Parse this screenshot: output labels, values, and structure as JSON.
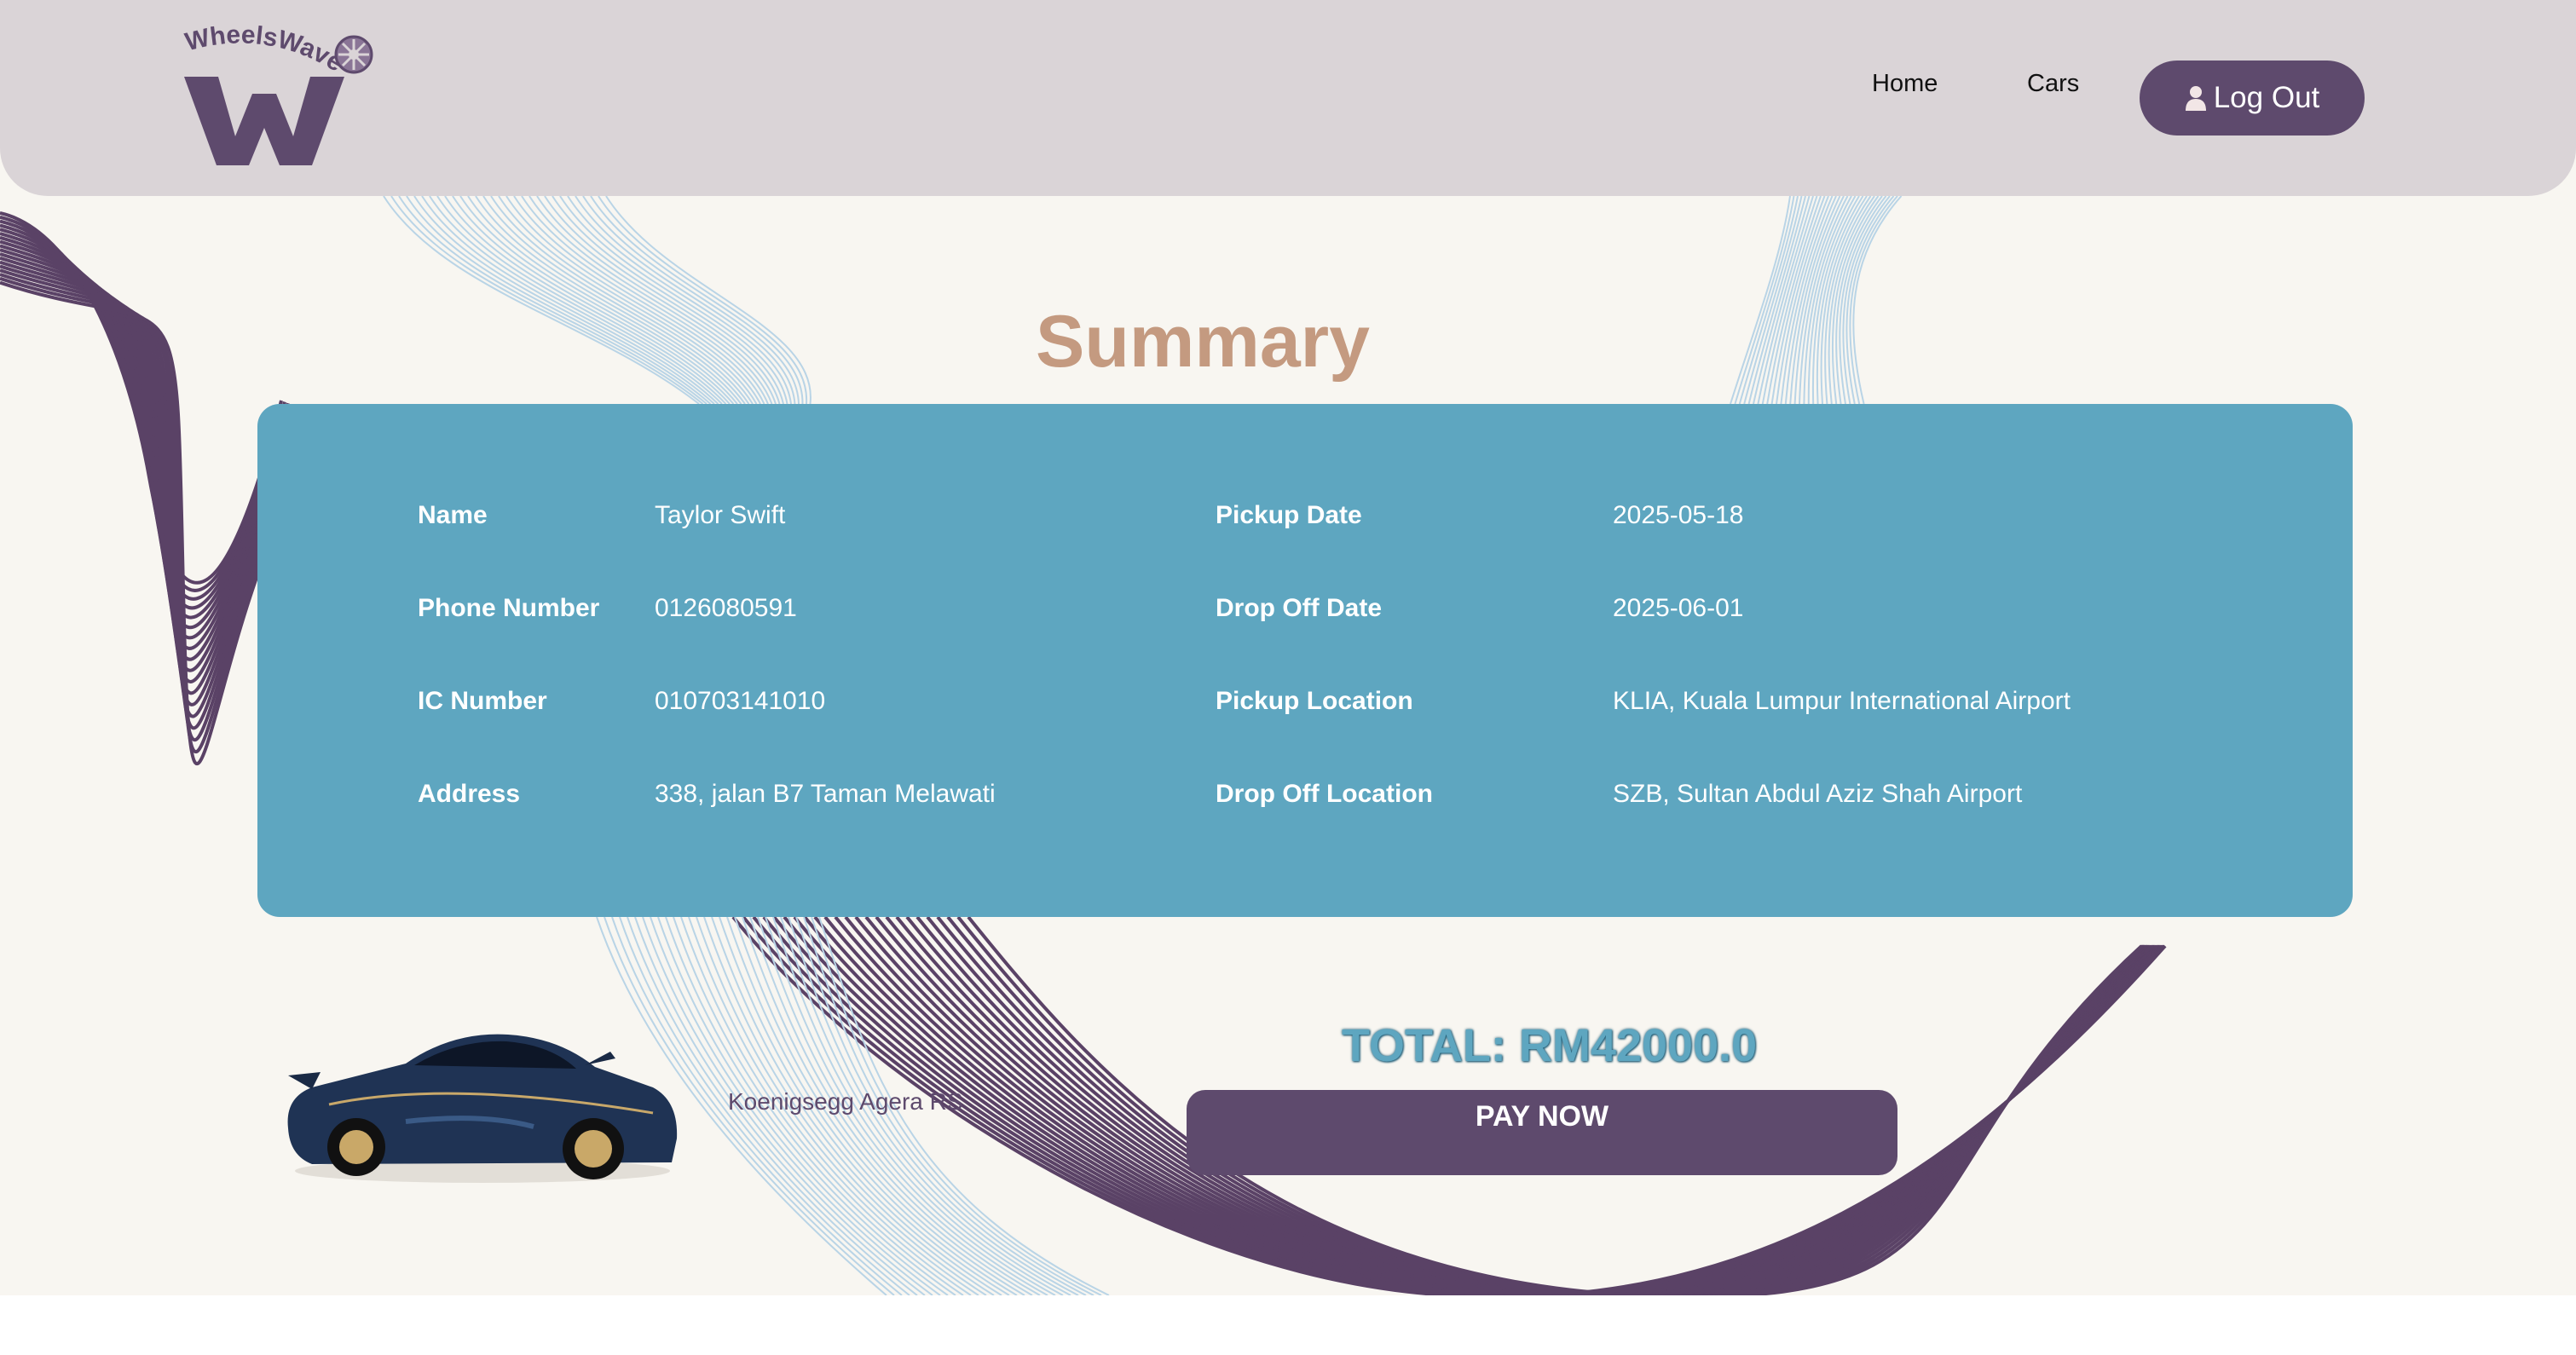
{
  "header": {
    "logo_text": "WheelsWave",
    "nav": {
      "home_label": "Home",
      "cars_label": "Cars"
    },
    "logout_label": "Log Out"
  },
  "summary": {
    "title": "Summary",
    "fields": {
      "name_label": "Name",
      "name_value": "Taylor Swift",
      "phone_label": "Phone Number",
      "phone_value": "0126080591",
      "ic_label": "IC Number",
      "ic_value": "010703141010",
      "address_label": "Address",
      "address_value": "338, jalan B7 Taman Melawati",
      "pickup_date_label": "Pickup Date",
      "pickup_date_value": "2025-05-18",
      "dropoff_date_label": "Drop Off Date",
      "dropoff_date_value": "2025-06-01",
      "pickup_location_label": "Pickup Location",
      "pickup_location_value": "KLIA, Kuala Lumpur International Airport",
      "dropoff_location_label": "Drop Off Location",
      "dropoff_location_value": "SZB, Sultan Abdul Aziz Shah Airport"
    }
  },
  "booking": {
    "car_name": "Koenigsegg Agera RS",
    "total_text": "TOTAL: RM42000.0",
    "pay_label": "PAY NOW"
  },
  "colors": {
    "header_bg": "#dad4d7",
    "brand_purple": "#5e4a6d",
    "card_blue": "#5ea6c0",
    "title_tan": "#c49a80",
    "page_bg": "#f8f6f1"
  },
  "icons": {
    "logout": "user-icon",
    "logo_wheel": "wheel-icon"
  }
}
